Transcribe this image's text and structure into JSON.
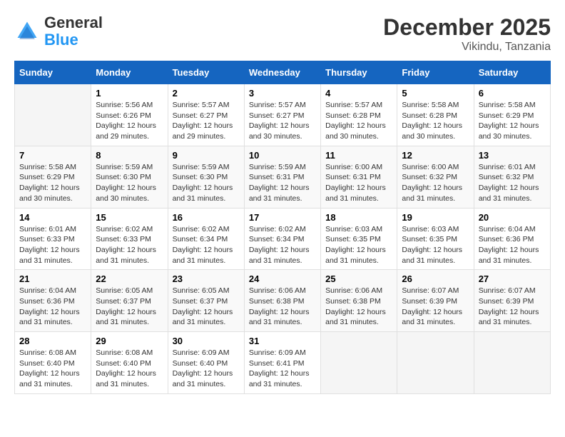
{
  "logo": {
    "general": "General",
    "blue": "Blue"
  },
  "title": {
    "month_year": "December 2025",
    "location": "Vikindu, Tanzania"
  },
  "weekdays": [
    "Sunday",
    "Monday",
    "Tuesday",
    "Wednesday",
    "Thursday",
    "Friday",
    "Saturday"
  ],
  "weeks": [
    [
      {
        "day": null
      },
      {
        "day": "1",
        "sunrise": "5:56 AM",
        "sunset": "6:26 PM",
        "daylight": "12 hours and 29 minutes."
      },
      {
        "day": "2",
        "sunrise": "5:57 AM",
        "sunset": "6:27 PM",
        "daylight": "12 hours and 29 minutes."
      },
      {
        "day": "3",
        "sunrise": "5:57 AM",
        "sunset": "6:27 PM",
        "daylight": "12 hours and 30 minutes."
      },
      {
        "day": "4",
        "sunrise": "5:57 AM",
        "sunset": "6:28 PM",
        "daylight": "12 hours and 30 minutes."
      },
      {
        "day": "5",
        "sunrise": "5:58 AM",
        "sunset": "6:28 PM",
        "daylight": "12 hours and 30 minutes."
      },
      {
        "day": "6",
        "sunrise": "5:58 AM",
        "sunset": "6:29 PM",
        "daylight": "12 hours and 30 minutes."
      }
    ],
    [
      {
        "day": "7",
        "sunrise": "5:58 AM",
        "sunset": "6:29 PM",
        "daylight": "12 hours and 30 minutes."
      },
      {
        "day": "8",
        "sunrise": "5:59 AM",
        "sunset": "6:30 PM",
        "daylight": "12 hours and 30 minutes."
      },
      {
        "day": "9",
        "sunrise": "5:59 AM",
        "sunset": "6:30 PM",
        "daylight": "12 hours and 31 minutes."
      },
      {
        "day": "10",
        "sunrise": "5:59 AM",
        "sunset": "6:31 PM",
        "daylight": "12 hours and 31 minutes."
      },
      {
        "day": "11",
        "sunrise": "6:00 AM",
        "sunset": "6:31 PM",
        "daylight": "12 hours and 31 minutes."
      },
      {
        "day": "12",
        "sunrise": "6:00 AM",
        "sunset": "6:32 PM",
        "daylight": "12 hours and 31 minutes."
      },
      {
        "day": "13",
        "sunrise": "6:01 AM",
        "sunset": "6:32 PM",
        "daylight": "12 hours and 31 minutes."
      }
    ],
    [
      {
        "day": "14",
        "sunrise": "6:01 AM",
        "sunset": "6:33 PM",
        "daylight": "12 hours and 31 minutes."
      },
      {
        "day": "15",
        "sunrise": "6:02 AM",
        "sunset": "6:33 PM",
        "daylight": "12 hours and 31 minutes."
      },
      {
        "day": "16",
        "sunrise": "6:02 AM",
        "sunset": "6:34 PM",
        "daylight": "12 hours and 31 minutes."
      },
      {
        "day": "17",
        "sunrise": "6:02 AM",
        "sunset": "6:34 PM",
        "daylight": "12 hours and 31 minutes."
      },
      {
        "day": "18",
        "sunrise": "6:03 AM",
        "sunset": "6:35 PM",
        "daylight": "12 hours and 31 minutes."
      },
      {
        "day": "19",
        "sunrise": "6:03 AM",
        "sunset": "6:35 PM",
        "daylight": "12 hours and 31 minutes."
      },
      {
        "day": "20",
        "sunrise": "6:04 AM",
        "sunset": "6:36 PM",
        "daylight": "12 hours and 31 minutes."
      }
    ],
    [
      {
        "day": "21",
        "sunrise": "6:04 AM",
        "sunset": "6:36 PM",
        "daylight": "12 hours and 31 minutes."
      },
      {
        "day": "22",
        "sunrise": "6:05 AM",
        "sunset": "6:37 PM",
        "daylight": "12 hours and 31 minutes."
      },
      {
        "day": "23",
        "sunrise": "6:05 AM",
        "sunset": "6:37 PM",
        "daylight": "12 hours and 31 minutes."
      },
      {
        "day": "24",
        "sunrise": "6:06 AM",
        "sunset": "6:38 PM",
        "daylight": "12 hours and 31 minutes."
      },
      {
        "day": "25",
        "sunrise": "6:06 AM",
        "sunset": "6:38 PM",
        "daylight": "12 hours and 31 minutes."
      },
      {
        "day": "26",
        "sunrise": "6:07 AM",
        "sunset": "6:39 PM",
        "daylight": "12 hours and 31 minutes."
      },
      {
        "day": "27",
        "sunrise": "6:07 AM",
        "sunset": "6:39 PM",
        "daylight": "12 hours and 31 minutes."
      }
    ],
    [
      {
        "day": "28",
        "sunrise": "6:08 AM",
        "sunset": "6:40 PM",
        "daylight": "12 hours and 31 minutes."
      },
      {
        "day": "29",
        "sunrise": "6:08 AM",
        "sunset": "6:40 PM",
        "daylight": "12 hours and 31 minutes."
      },
      {
        "day": "30",
        "sunrise": "6:09 AM",
        "sunset": "6:40 PM",
        "daylight": "12 hours and 31 minutes."
      },
      {
        "day": "31",
        "sunrise": "6:09 AM",
        "sunset": "6:41 PM",
        "daylight": "12 hours and 31 minutes."
      },
      {
        "day": null
      },
      {
        "day": null
      },
      {
        "day": null
      }
    ]
  ]
}
